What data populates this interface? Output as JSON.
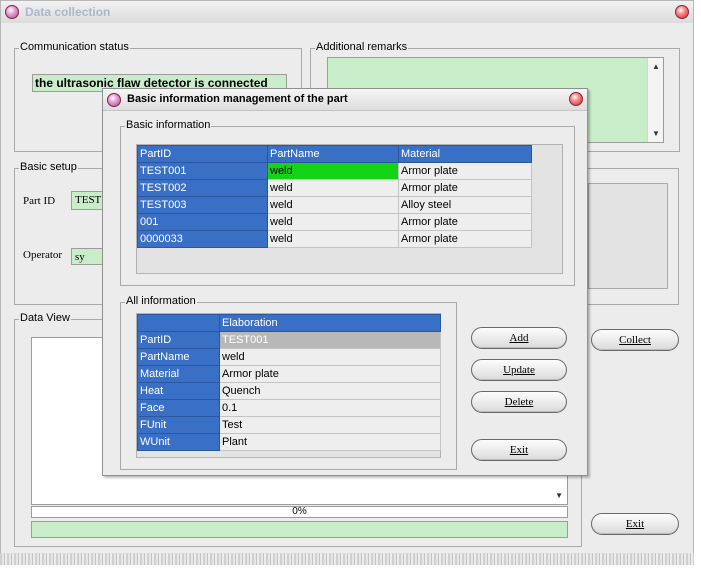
{
  "main": {
    "title": "Data collection",
    "communication_status": {
      "label": "Communication status",
      "message": "the ultrasonic flaw detector is connected"
    },
    "additional_remarks": {
      "label": "Additional remarks",
      "value": ""
    },
    "basic_setup": {
      "label": "Basic setup",
      "part_id_label": "Part ID",
      "part_id_value": "TEST",
      "operator_label": "Operator",
      "operator_value": "sy"
    },
    "data_view": {
      "label": "Data View",
      "progress_text": "0%",
      "progress": 0
    },
    "collect_button": "Collect",
    "exit_button": "Exit"
  },
  "dialog": {
    "title": "Basic information management of the part",
    "basic_info": {
      "label": "Basic information",
      "columns": [
        "PartID",
        "PartName",
        "Material"
      ],
      "rows": [
        [
          "TEST001",
          "weld",
          "Armor plate"
        ],
        [
          "TEST002",
          "weld",
          "Armor plate"
        ],
        [
          "TEST003",
          "weld",
          "Alloy steel"
        ],
        [
          "001",
          "weld",
          "Armor plate"
        ],
        [
          "0000033",
          "weld",
          "Armor plate"
        ]
      ]
    },
    "all_info": {
      "label": "All information",
      "header": "Elaboration",
      "rows": [
        {
          "key": "PartID",
          "value": "TEST001"
        },
        {
          "key": "PartName",
          "value": "weld"
        },
        {
          "key": "Material",
          "value": "Armor plate"
        },
        {
          "key": "Heat",
          "value": "Quench"
        },
        {
          "key": "Face",
          "value": "0.1"
        },
        {
          "key": "FUnit",
          "value": "Test"
        },
        {
          "key": "WUnit",
          "value": "Plant"
        }
      ]
    },
    "buttons": {
      "add": "Add",
      "update": "Update",
      "delete": "Delete",
      "exit": "Exit"
    }
  },
  "colors": {
    "grid_header": "#3a6fc6",
    "selected_cell": "#14d314",
    "field_green": "#c9ecc9"
  }
}
